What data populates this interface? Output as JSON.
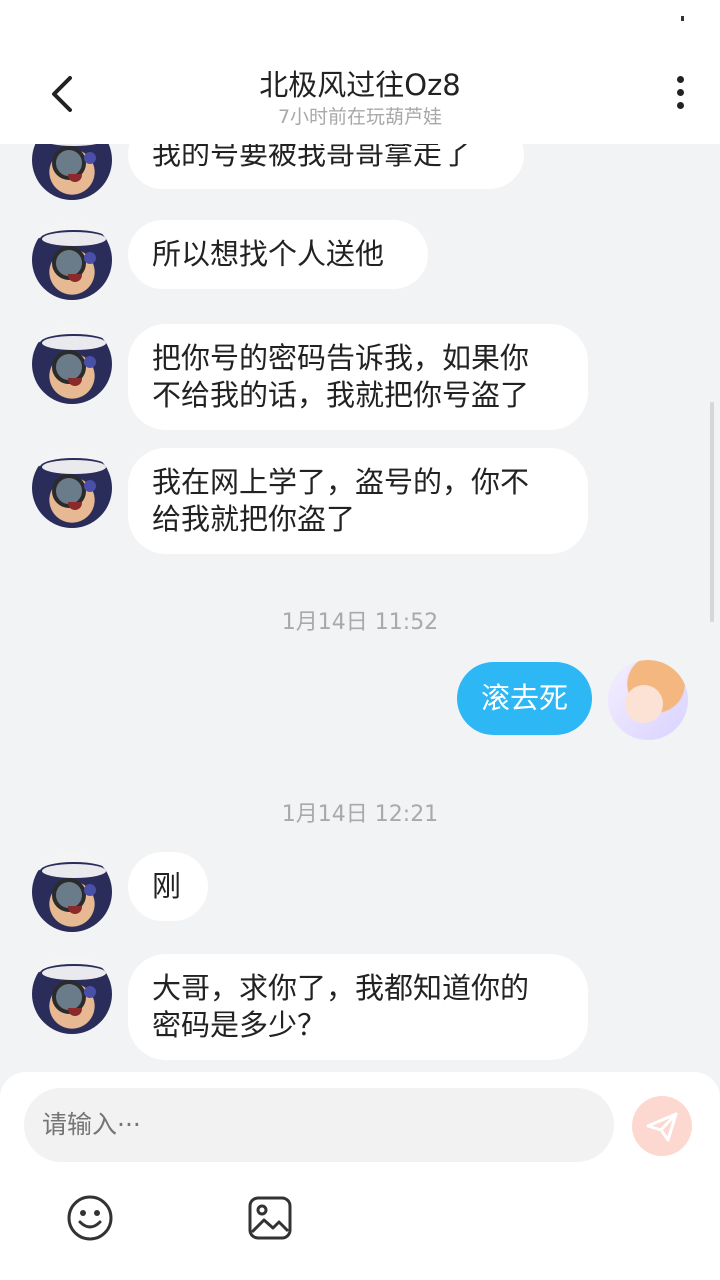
{
  "header": {
    "title": "北极风过往Oz8",
    "subtitle": "7小时前在玩葫芦娃"
  },
  "messages": [
    {
      "side": "left",
      "text": "我的号要被我哥哥拿走了"
    },
    {
      "side": "left",
      "text": "所以想找个人送他"
    },
    {
      "side": "left",
      "lines": [
        "把你号的密码告诉我，如果你",
        "不给我的话，我就把你号盗了"
      ]
    },
    {
      "side": "left",
      "lines": [
        "我在网上学了，盗号的，你不",
        "给我就把你盗了"
      ]
    },
    {
      "type": "time",
      "text": "1月14日 11:52"
    },
    {
      "side": "right",
      "text": "滚去死"
    },
    {
      "type": "time",
      "text": "1月14日 12:21"
    },
    {
      "side": "left",
      "text": "刚"
    },
    {
      "side": "left",
      "lines": [
        "大哥，求你了，我都知道你的",
        "密码是多少？"
      ]
    }
  ],
  "composer": {
    "placeholder": "请输入···"
  },
  "icons": {
    "back": "chevron-left-icon",
    "more": "more-vertical-icon",
    "send": "paper-plane-icon",
    "emoji": "smiley-icon",
    "image": "image-icon"
  },
  "colors": {
    "accent": "#2db7f5",
    "background": "#f2f3f5",
    "send_disabled": "#fcd8d0"
  }
}
